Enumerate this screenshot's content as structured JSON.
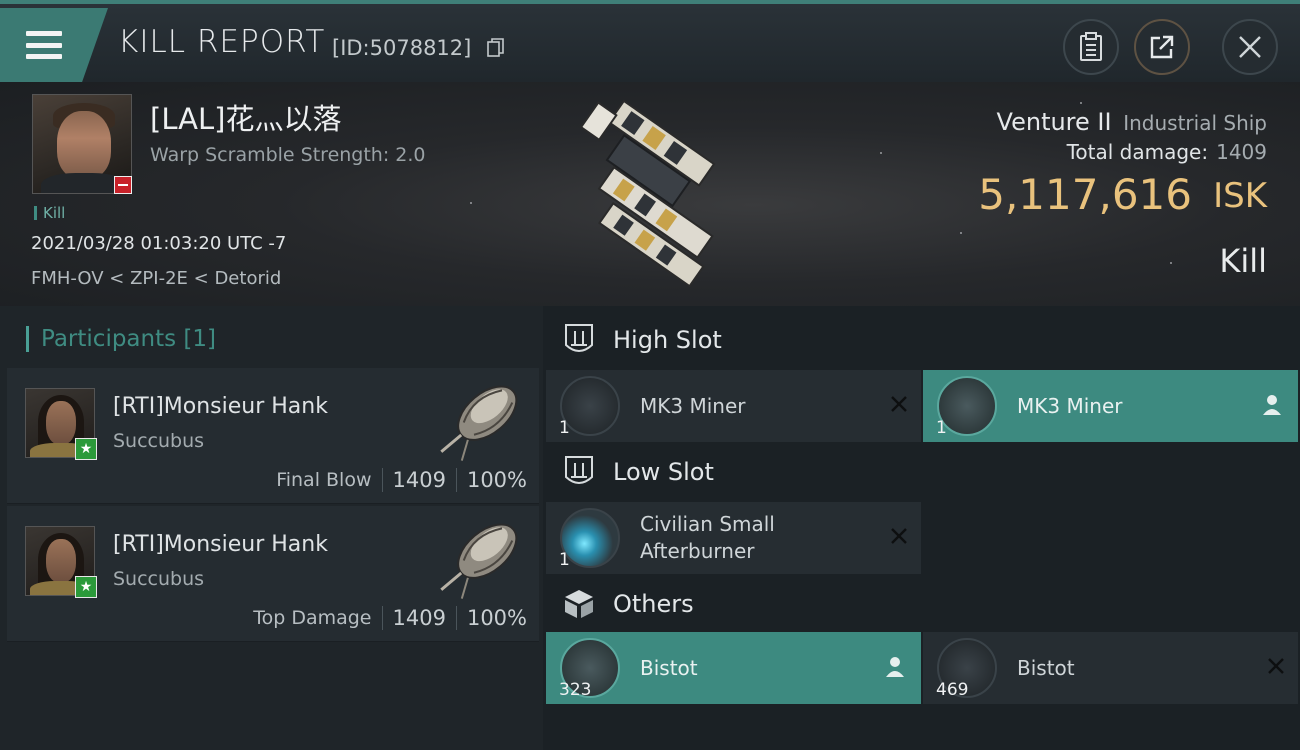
{
  "header": {
    "menu_label": "Menu",
    "title": "KILL REPORT",
    "report_id": "[ID:5078812]"
  },
  "victim": {
    "name": "[LAL]花灬以落",
    "warp_scramble": "Warp Scramble Strength: 2.0",
    "tag": "Kill",
    "datetime": "2021/03/28 01:03:20 UTC -7",
    "location": "FMH-OV < ZPI-2E < Detorid",
    "ship_name": "Venture II",
    "ship_class": "Industrial Ship",
    "total_damage_label": "Total damage:",
    "total_damage_value": "1409",
    "isk_value": "5,117,616",
    "isk_unit": "ISK",
    "result": "Kill"
  },
  "participants": {
    "title": "Participants [1]",
    "items": [
      {
        "name": "[RTI]Monsieur Hank",
        "ship": "Succubus",
        "role": "Final Blow",
        "damage": "1409",
        "percent": "100%"
      },
      {
        "name": "[RTI]Monsieur Hank",
        "ship": "Succubus",
        "role": "Top Damage",
        "damage": "1409",
        "percent": "100%"
      }
    ]
  },
  "fitting": {
    "high_slot": {
      "label": "High Slot",
      "items": [
        {
          "name": "MK3 Miner",
          "qty": "1",
          "state": "destroyed"
        },
        {
          "name": "MK3 Miner",
          "qty": "1",
          "state": "dropped"
        }
      ]
    },
    "low_slot": {
      "label": "Low Slot",
      "items": [
        {
          "name_line1": "Civilian Small",
          "name_line2": "Afterburner",
          "qty": "1",
          "state": "destroyed"
        }
      ]
    },
    "others": {
      "label": "Others",
      "items": [
        {
          "name": "Bistot",
          "qty": "323",
          "state": "dropped"
        },
        {
          "name": "Bistot",
          "qty": "469",
          "state": "destroyed"
        }
      ]
    }
  },
  "colors": {
    "accent_teal": "#3d8a80",
    "isk_gold": "#e9c27d",
    "loss_red": "#c8222a",
    "ally_green": "#2b9a3a"
  }
}
